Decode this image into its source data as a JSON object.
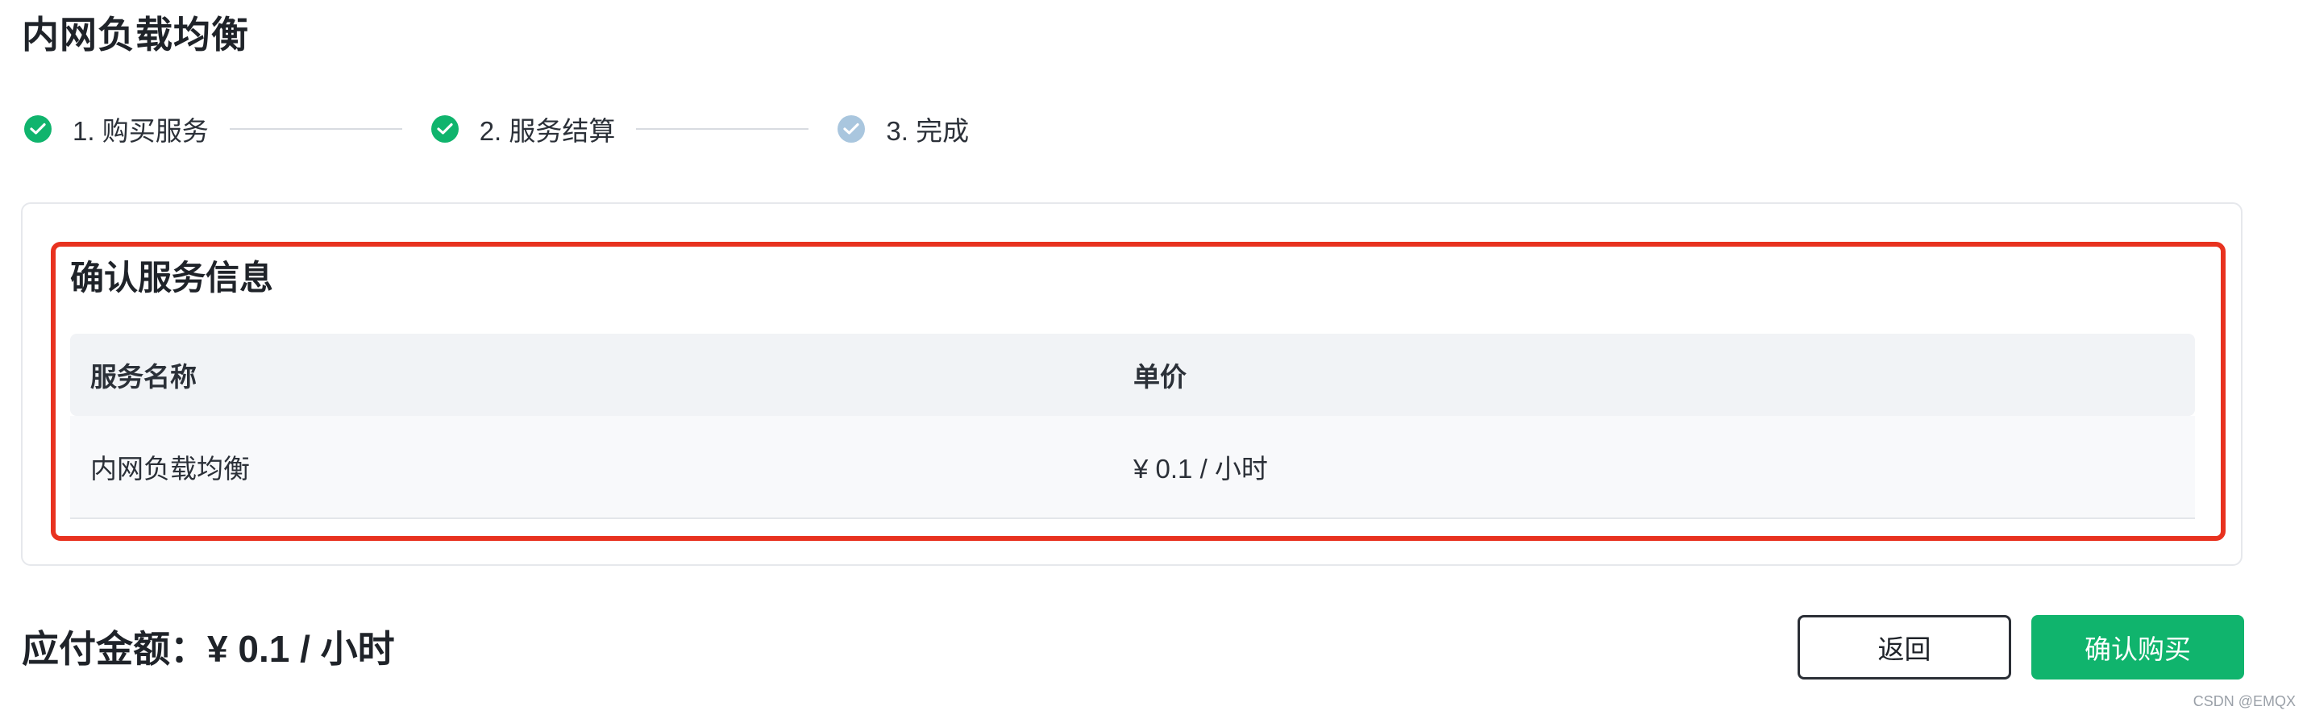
{
  "page": {
    "title": "内网负载均衡"
  },
  "steps": [
    {
      "label": "1. 购买服务",
      "status": "done"
    },
    {
      "label": "2. 服务结算",
      "status": "done"
    },
    {
      "label": "3. 完成",
      "status": "pending"
    }
  ],
  "colors": {
    "accent": "#10b46d",
    "pending": "#a9c6de",
    "highlight": "#e8321f"
  },
  "confirm_section": {
    "title": "确认服务信息",
    "table": {
      "headers": [
        "服务名称",
        "单价"
      ],
      "rows": [
        [
          "内网负载均衡",
          "¥ 0.1 / 小时"
        ]
      ]
    }
  },
  "footer": {
    "total_text": "应付金额：¥ 0.1 / 小时",
    "back_label": "返回",
    "confirm_label": "确认购买"
  },
  "watermark": "CSDN @EMQX"
}
